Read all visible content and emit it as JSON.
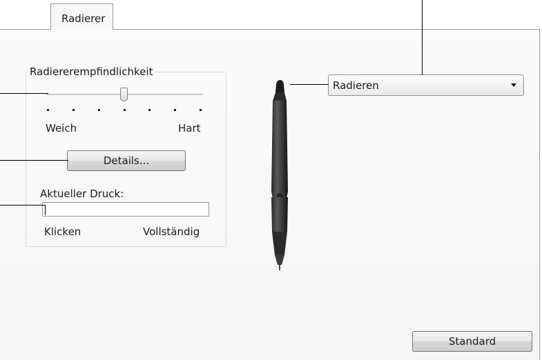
{
  "tab": {
    "label": "Radierer"
  },
  "sensitivity": {
    "title": "Radiererempfindlichkeit",
    "min_label": "Weich",
    "max_label": "Hart",
    "tick_count": 7,
    "level_fraction": 0.5
  },
  "details_button": {
    "label": "Details..."
  },
  "pressure": {
    "label": "Aktueller Druck:",
    "left_label": "Klicken",
    "right_label": "Vollständig",
    "value_fraction": 0
  },
  "eraser_function": {
    "selected": "Radieren"
  },
  "default_button": {
    "label": "Standard"
  },
  "icons": {
    "dropdown": "chevron-down-icon",
    "pen": "pen-illustration"
  }
}
